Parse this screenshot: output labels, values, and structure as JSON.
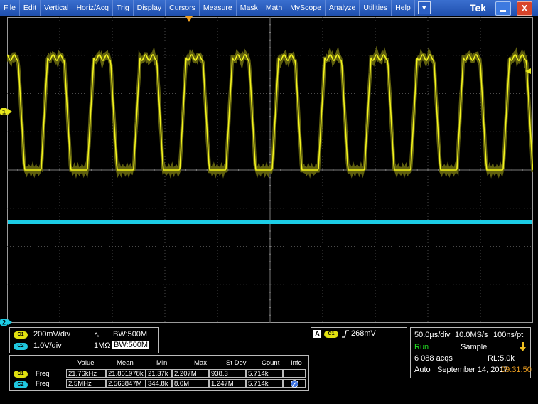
{
  "menu": {
    "items": [
      "File",
      "Edit",
      "Vertical",
      "Horiz/Acq",
      "Trig",
      "Display",
      "Cursors",
      "Measure",
      "Mask",
      "Math",
      "MyScope",
      "Analyze",
      "Utilities",
      "Help"
    ],
    "brand": "Tek",
    "close_glyph": "X"
  },
  "colors": {
    "ch1": "#e8e81c",
    "ch2": "#1ccde6",
    "menubar": "#2a5cbf"
  },
  "markers": {
    "ch1": "1",
    "ch2": "2"
  },
  "vertical": {
    "ch1": {
      "badge": "C1",
      "scale": "200mV/div",
      "coupling_icon": "ac-coupling-icon",
      "bw_label": "BW:500M"
    },
    "ch2": {
      "badge": "C2",
      "scale": "1.0V/div",
      "termination": "1MΩ",
      "bw_label": "BW:500M"
    }
  },
  "trigger": {
    "source_badge": "A",
    "channel_badge": "C1",
    "slope_icon": "rising-edge-icon",
    "level": "268mV"
  },
  "horizontal": {
    "scale": "50.0µs/div",
    "sample_rate": "10.0MS/s",
    "resolution": "100ns/pt",
    "state": "Run",
    "acq_mode": "Sample",
    "acqs": "6 088 acqs",
    "record_length": "RL:5.0k",
    "trigger_mode": "Auto",
    "date": "September 14, 2017",
    "time": "09:31:50"
  },
  "measurements": {
    "headers": [
      "Value",
      "Mean",
      "Min",
      "Max",
      "St Dev",
      "Count",
      "Info"
    ],
    "rows": [
      {
        "channel": "C1",
        "name": "Freq",
        "value": "21.76kHz",
        "mean": "21.861978k",
        "min": "21.37k",
        "max": "2.207M",
        "stdev": "938.3",
        "count": "5.714k"
      },
      {
        "channel": "C2",
        "name": "Freq",
        "value": "2.5MHz",
        "mean": "2.563847M",
        "min": "344.8k",
        "max": "8.0M",
        "stdev": "1.247M",
        "count": "5.714k"
      }
    ]
  }
}
